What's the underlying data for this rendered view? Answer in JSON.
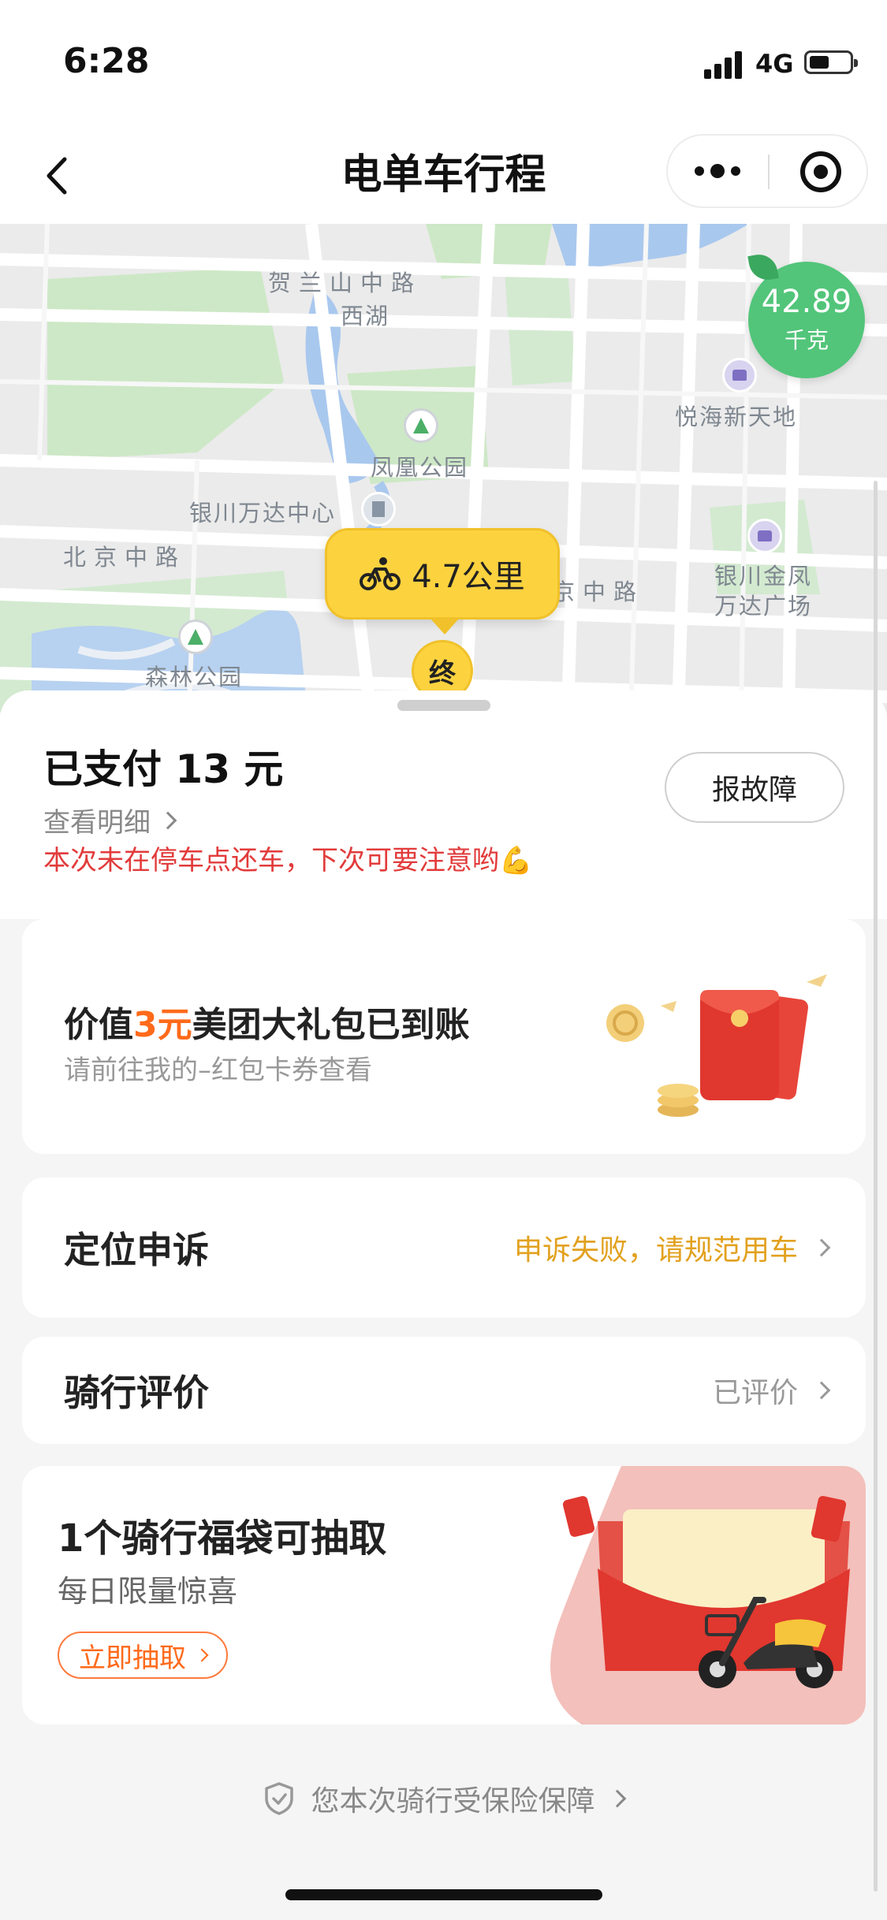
{
  "status_bar": {
    "time": "6:28",
    "network": "4G"
  },
  "nav": {
    "title": "电单车行程",
    "back_icon": "chevron-left-icon",
    "more_icon": "more-dots-icon",
    "close_icon": "target-circle-icon"
  },
  "map": {
    "labels": {
      "helanshan_road": "贺兰山中路",
      "west_lake": "西湖",
      "fenghuang_park": "凤凰公园",
      "wanda_center": "银川万达中心",
      "beijing_road": "北京中路",
      "beijing_road_east": "京中路",
      "yuehai": "悦海新天地",
      "jinfeng_wanda_1": "银川金凤",
      "jinfeng_wanda_2": "万达广场",
      "forest_park": "森林公园"
    },
    "distance": "4.7公里",
    "end_marker": "终",
    "carbon_value": "42.89",
    "carbon_unit": "千克",
    "colors": {
      "badge": "#fcd23f",
      "carbon": "#52c57a"
    }
  },
  "summary": {
    "paid": "已支付 13 元",
    "detail_link": "查看明细",
    "warning": "本次未在停车点还车，下次可要注意哟💪",
    "report_button": "报故障"
  },
  "gift": {
    "title_prefix": "价值",
    "title_highlight": "3元",
    "title_suffix": "美团大礼包已到账",
    "subtitle": "请前往我的–红包卡券查看"
  },
  "appeal": {
    "title": "定位申诉",
    "status": "申诉失败，请规范用车"
  },
  "review": {
    "title": "骑行评价",
    "status": "已评价"
  },
  "lucky_bag": {
    "title": "1个骑行福袋可抽取",
    "subtitle": "每日限量惊喜",
    "button": "立即抽取"
  },
  "insurance": {
    "text": "您本次骑行受保险保障"
  }
}
